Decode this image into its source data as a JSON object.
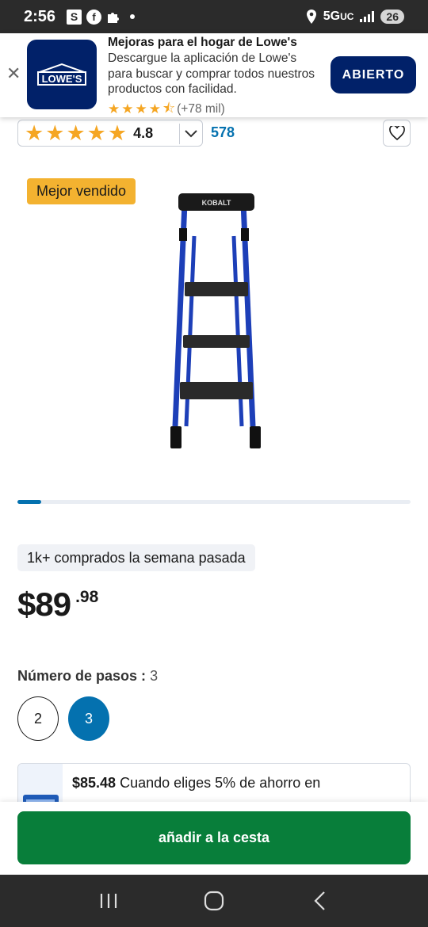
{
  "status_bar": {
    "time": "2:56",
    "app_badge_s": "S",
    "network": "5G",
    "network_suffix": "UC",
    "battery": "26"
  },
  "app_banner": {
    "logo_text": "LOWE'S",
    "title": "Mejoras para el hogar de Lowe's",
    "description": "Descargue la aplicación de Lowe's para buscar y comprar todos nuestros productos con facilidad.",
    "rating_stars": 4.5,
    "rating_count": "(+78 mil)",
    "open_label": "ABIERTO"
  },
  "product": {
    "rating_value": "4.8",
    "review_count": "578",
    "badge": "Mejor vendido",
    "brand_on_image": "KOBALT",
    "carousel_progress": 0.06,
    "purchased_note": "1k+ comprados la semana pasada",
    "price_main": "$89",
    "price_cents": ".98",
    "steps_label": "Número de pasos :",
    "steps_selected": "3",
    "steps_options": [
      "2",
      "3"
    ],
    "savings_amount": "$85.48",
    "savings_text": "Cuando eliges 5% de ahorro en"
  },
  "cart": {
    "add_label": "añadir a la cesta"
  },
  "colors": {
    "lowes_blue": "#012169",
    "link_blue": "#0471af",
    "cart_green": "#087e3a",
    "badge_yellow": "#f3b230"
  }
}
